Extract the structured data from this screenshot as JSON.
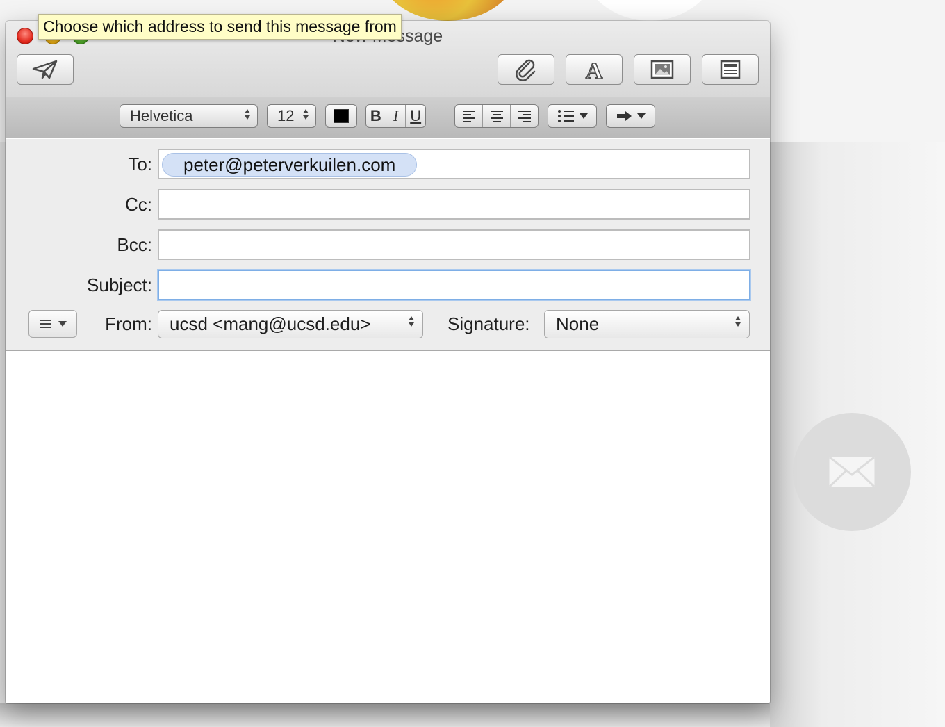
{
  "window": {
    "title": "New Message"
  },
  "toolbar": {
    "send_icon": "paper-plane-icon",
    "attach_icon": "paperclip-icon",
    "fonts_icon": "letter-a-icon",
    "photo_icon": "photo-browser-icon",
    "stationery_icon": "stationery-icon"
  },
  "format_bar": {
    "font_family": "Helvetica",
    "font_size": "12",
    "text_color": "#000000",
    "bold": "B",
    "italic": "I",
    "underline": "U",
    "align_icons": [
      "align-left-icon",
      "align-center-icon",
      "align-right-icon"
    ],
    "list_icon": "bulleted-list-icon",
    "indent_icon": "indent-arrow-icon"
  },
  "headers": {
    "to_label": "To:",
    "to_recipients": [
      "peter@peterverkuilen.com"
    ],
    "cc_label": "Cc:",
    "cc_value": "",
    "bcc_label": "Bcc:",
    "bcc_value": "",
    "subject_label": "Subject:",
    "subject_value": "",
    "from_label": "From:",
    "from_value": "ucsd <mang@ucsd.edu>",
    "signature_label": "Signature:",
    "signature_value": "None"
  },
  "tooltip": {
    "text": "Choose which address to send this message from"
  },
  "colors": {
    "token_background": "#d4e1f6",
    "focus_ring": "#7eaee6",
    "tooltip_background": "#fffdc6"
  }
}
